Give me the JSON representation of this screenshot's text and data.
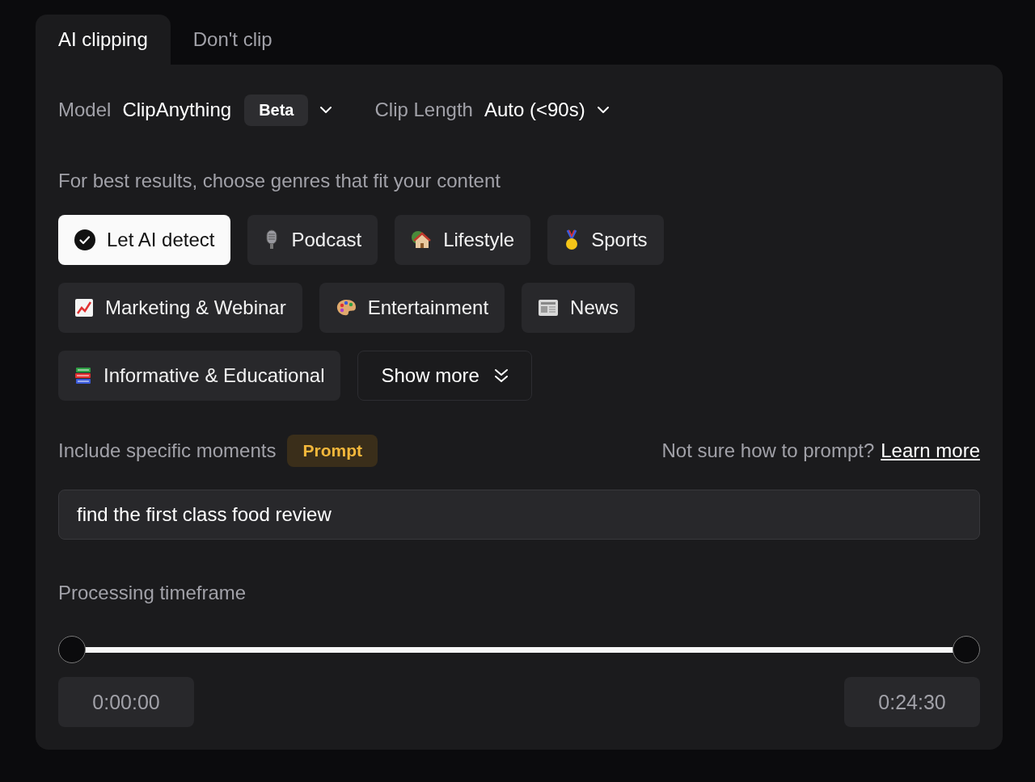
{
  "tabs": [
    {
      "label": "AI clipping",
      "selected": true
    },
    {
      "label": "Don't clip",
      "selected": false
    }
  ],
  "model": {
    "label": "Model",
    "value": "ClipAnything",
    "badge": "Beta"
  },
  "clip_length": {
    "label": "Clip Length",
    "value": "Auto (<90s)"
  },
  "genres_hint": "For best results, choose genres that fit your content",
  "genres": [
    {
      "label": "Let AI detect",
      "selected": true
    },
    {
      "label": "Podcast",
      "selected": false
    },
    {
      "label": "Lifestyle",
      "selected": false
    },
    {
      "label": "Sports",
      "selected": false
    },
    {
      "label": "Marketing & Webinar",
      "selected": false
    },
    {
      "label": "Entertainment",
      "selected": false
    },
    {
      "label": "News",
      "selected": false
    },
    {
      "label": "Informative & Educational",
      "selected": false
    }
  ],
  "show_more": "Show more",
  "prompt": {
    "label": "Include specific moments",
    "badge": "Prompt",
    "help": "Not sure how to prompt?",
    "link": "Learn more",
    "value": "find the first class food review"
  },
  "timeframe": {
    "label": "Processing timeframe",
    "handles": [
      {
        "level": 0
      },
      {
        "level": 1
      }
    ],
    "start": "0:00:00",
    "end": "0:24:30"
  }
}
